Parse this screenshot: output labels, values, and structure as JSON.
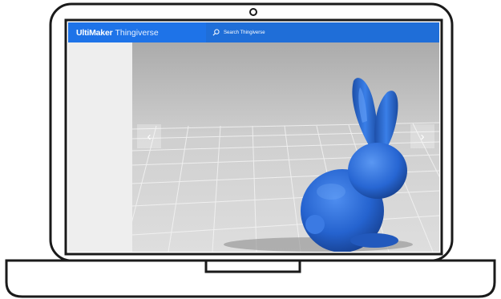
{
  "nav": {
    "brand_strong": "UltiMaker",
    "brand_light": "Thingiverse",
    "search_placeholder": "Search Thingiverse"
  },
  "viewer": {
    "prev_label": "‹",
    "next_label": "›",
    "model_color": "#2a6dd9"
  },
  "colors": {
    "accent": "#1e73e8"
  }
}
